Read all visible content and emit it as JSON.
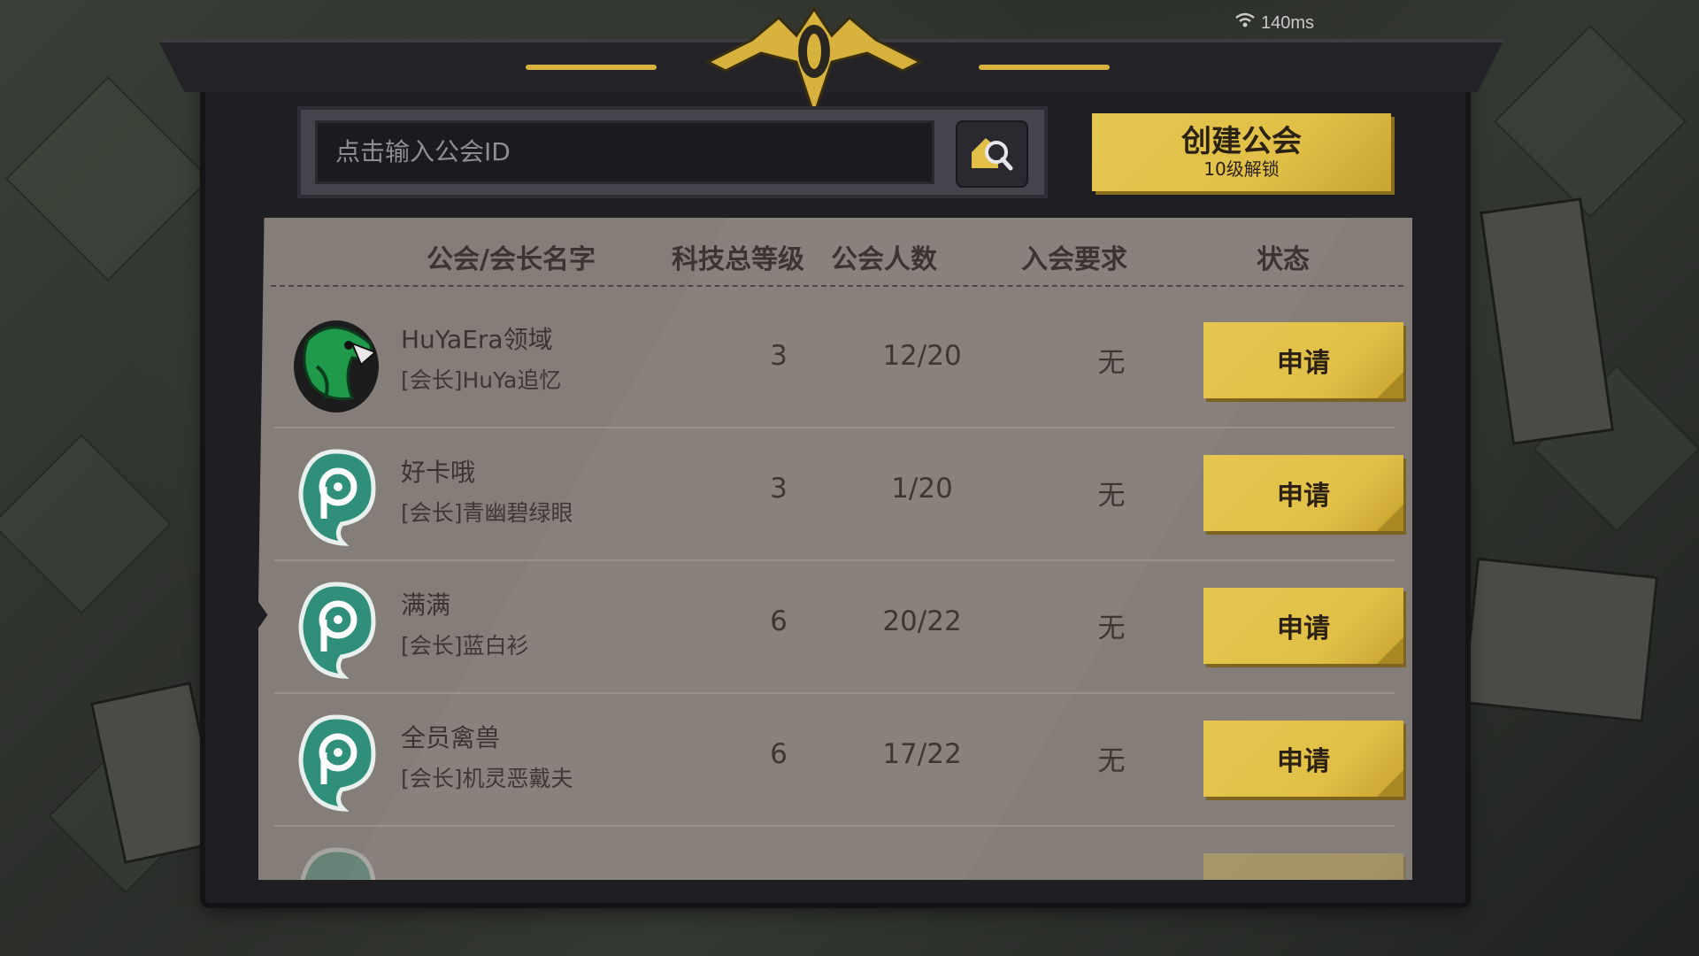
{
  "status": {
    "ping": "140ms"
  },
  "search": {
    "placeholder": "点击输入公会ID"
  },
  "create_button": {
    "label": "创建公会",
    "sublabel": "10级解锁"
  },
  "table": {
    "headers": {
      "name": "公会/会长名字",
      "tech_level": "科技总等级",
      "members": "公会人数",
      "requirement": "入会要求",
      "status": "状态"
    },
    "rows": [
      {
        "name": "HuYaEra领域",
        "leader": "[会长]HuYa追忆",
        "tech_level": "3",
        "members": "12/20",
        "requirement": "无",
        "action": "申请",
        "emblem": "eagle-emblem"
      },
      {
        "name": "好卡哦",
        "leader": "[会长]青幽碧绿眼",
        "tech_level": "3",
        "members": "1/20",
        "requirement": "无",
        "action": "申请",
        "emblem": "default-emblem"
      },
      {
        "name": "满满",
        "leader": "[会长]蓝白衫",
        "tech_level": "6",
        "members": "20/22",
        "requirement": "无",
        "action": "申请",
        "emblem": "default-emblem"
      },
      {
        "name": "全员禽兽",
        "leader": "[会长]机灵恶戴夫",
        "tech_level": "6",
        "members": "17/22",
        "requirement": "无",
        "action": "申请",
        "emblem": "default-emblem"
      }
    ]
  },
  "colors": {
    "accent_gold": "#e2c048",
    "panel": "#857d77",
    "emblem_teal": "#2f8f7a",
    "emblem_green": "#1f9a4a"
  }
}
